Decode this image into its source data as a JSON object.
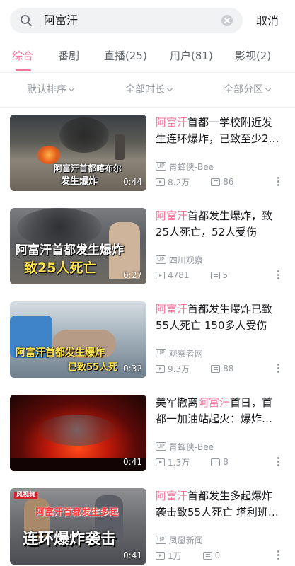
{
  "search": {
    "query": "阿富汗",
    "cancel_label": "取消"
  },
  "tabs": [
    {
      "label": "综合",
      "active": true
    },
    {
      "label": "番剧"
    },
    {
      "label": "直播(25)"
    },
    {
      "label": "用户(81)"
    },
    {
      "label": "影视(2)"
    }
  ],
  "filters": [
    {
      "label": "默认排序"
    },
    {
      "label": "全部时长"
    },
    {
      "label": "全部分区"
    }
  ],
  "videos": [
    {
      "title_pre": "",
      "title_hl": "阿富汗",
      "title_post": "首都一学校附近发生连环爆炸，已致至少2…",
      "author": "青蜂侠-Bee",
      "views": "8.2万",
      "danmaku": "86",
      "duration": "0:44",
      "overlay_lines": [
        "阿富汗首都喀布尔",
        "发生爆炸"
      ]
    },
    {
      "title_pre": "",
      "title_hl": "阿富汗",
      "title_post": "首都发生爆炸，致25人死亡，52人受伤",
      "author": "四川观察",
      "views": "4781",
      "danmaku": "5",
      "duration": "0:27",
      "overlay_lines": [
        "阿富汗首都发生爆炸",
        "致25人死亡"
      ]
    },
    {
      "title_pre": "",
      "title_hl": "阿富汗",
      "title_post": "首都发生爆炸已致55人死亡 150多人受伤",
      "author": "观察者网",
      "views": "9.3万",
      "danmaku": "88",
      "duration": "0:32",
      "overlay_lines": [
        "阿富汗首都发生爆炸",
        "已致55人死"
      ]
    },
    {
      "title_pre": "美军撤离",
      "title_hl": "阿富汗",
      "title_post": "首日，首都一加油站起火：爆炸…",
      "author": "青蜂侠-Bee",
      "views": "1.3万",
      "danmaku": "8",
      "duration": "0:41",
      "overlay_lines": []
    },
    {
      "title_pre": "",
      "title_hl": "阿富汗",
      "title_post": "首都发生多起爆炸袭击致55人死亡 塔利班…",
      "author": "凤凰新闻",
      "views": "1万",
      "danmaku": "0",
      "duration": "0:41",
      "overlay_lines": [
        "风视频",
        "阿富汗首都发生多起",
        "连环爆炸袭击"
      ]
    }
  ],
  "colors": {
    "accent": "#fb7299",
    "muted": "#9499a0"
  }
}
